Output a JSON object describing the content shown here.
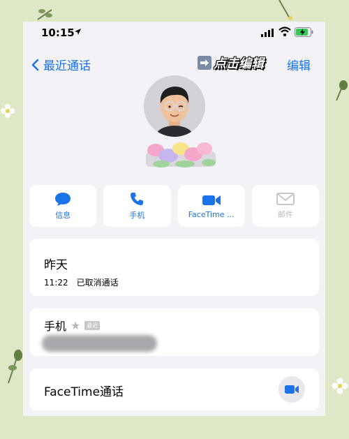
{
  "status_bar": {
    "time": "10:15"
  },
  "nav": {
    "back_label": "最近通话",
    "edit_label": "编辑",
    "annotation": "点击编辑"
  },
  "actions": [
    {
      "label": "信息",
      "icon": "message-icon"
    },
    {
      "label": "手机",
      "icon": "phone-icon"
    },
    {
      "label": "FaceTime ...",
      "icon": "video-icon"
    },
    {
      "label": "邮件",
      "icon": "mail-icon"
    }
  ],
  "recents": {
    "day": "昨天",
    "time": "11:22",
    "status": "已取消通话"
  },
  "phone_field": {
    "label": "手机",
    "badge": "最近"
  },
  "facetime": {
    "label": "FaceTime通话"
  },
  "colors": {
    "accent": "#1a73e8",
    "background": "#f2f2f7",
    "disabled": "#b8b8bd"
  }
}
